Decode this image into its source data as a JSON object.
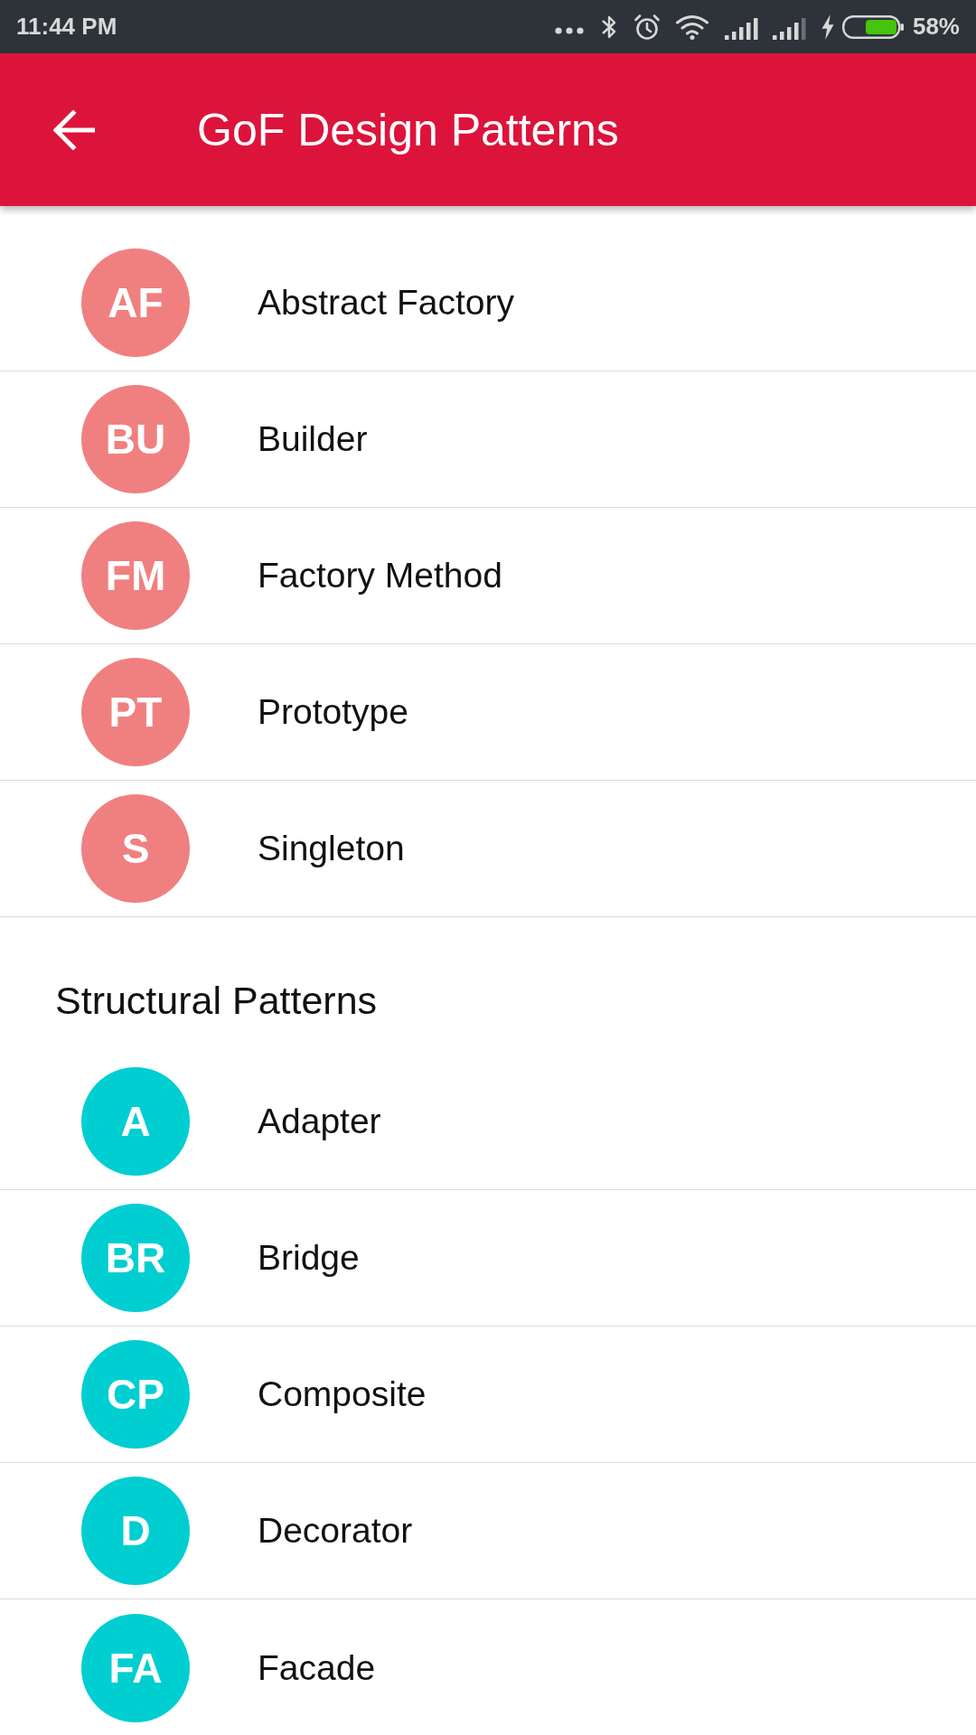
{
  "status_bar": {
    "time": "11:44 PM",
    "battery": "58%"
  },
  "app_bar": {
    "title": "GoF Design Patterns"
  },
  "groups": [
    {
      "items": [
        {
          "initials": "AF",
          "name": "Abstract Factory",
          "color": "#f08080"
        },
        {
          "initials": "BU",
          "name": "Builder",
          "color": "#f08080"
        },
        {
          "initials": "FM",
          "name": "Factory Method",
          "color": "#f08080"
        },
        {
          "initials": "PT",
          "name": "Prototype",
          "color": "#f08080"
        },
        {
          "initials": "S",
          "name": "Singleton",
          "color": "#f08080"
        }
      ]
    },
    {
      "title": "Structural Patterns",
      "items": [
        {
          "initials": "A",
          "name": "Adapter",
          "color": "#00ced1"
        },
        {
          "initials": "BR",
          "name": "Bridge",
          "color": "#00ced1"
        },
        {
          "initials": "CP",
          "name": "Composite",
          "color": "#00ced1"
        },
        {
          "initials": "D",
          "name": "Decorator",
          "color": "#00ced1"
        },
        {
          "initials": "FA",
          "name": "Facade",
          "color": "#00ced1"
        }
      ]
    }
  ]
}
